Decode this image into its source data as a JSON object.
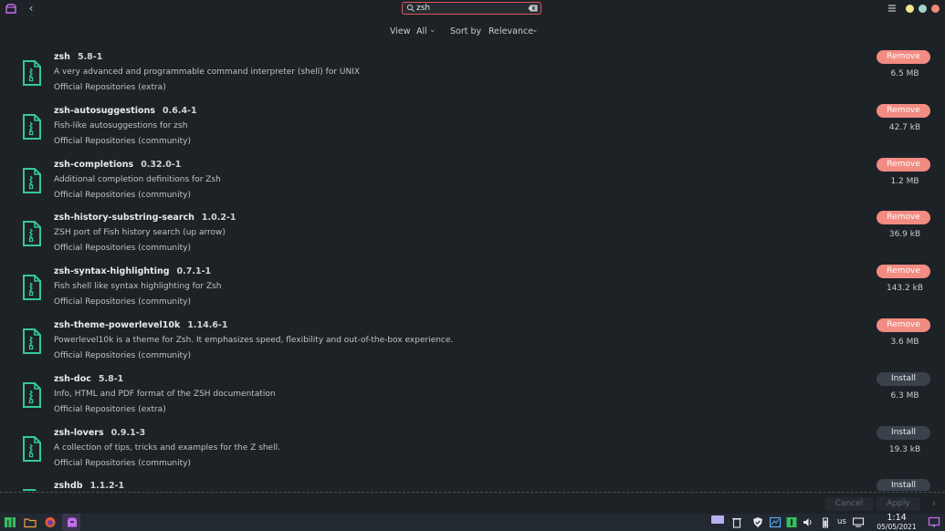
{
  "search": {
    "value": "zsh",
    "placeholder": ""
  },
  "filters": {
    "view_label": "View",
    "view_value": "All",
    "sort_label": "Sort by",
    "sort_value": "Relevance"
  },
  "packages": [
    {
      "name": "zsh",
      "version": "5.8-1",
      "description": "A very advanced and programmable command interpreter (shell) for UNIX",
      "repo": "Official Repositories (extra)",
      "action": "Remove",
      "size": "6.5 MB"
    },
    {
      "name": "zsh-autosuggestions",
      "version": "0.6.4-1",
      "description": "Fish-like autosuggestions for zsh",
      "repo": "Official Repositories (community)",
      "action": "Remove",
      "size": "42.7 kB"
    },
    {
      "name": "zsh-completions",
      "version": "0.32.0-1",
      "description": "Additional completion definitions for Zsh",
      "repo": "Official Repositories (community)",
      "action": "Remove",
      "size": "1.2 MB"
    },
    {
      "name": "zsh-history-substring-search",
      "version": "1.0.2-1",
      "description": "ZSH port of Fish history search (up arrow)",
      "repo": "Official Repositories (community)",
      "action": "Remove",
      "size": "36.9 kB"
    },
    {
      "name": "zsh-syntax-highlighting",
      "version": "0.7.1-1",
      "description": "Fish shell like syntax highlighting for Zsh",
      "repo": "Official Repositories (community)",
      "action": "Remove",
      "size": "143.2 kB"
    },
    {
      "name": "zsh-theme-powerlevel10k",
      "version": "1.14.6-1",
      "description": "Powerlevel10k is a theme for Zsh. It emphasizes speed, flexibility and out-of-the-box experience.",
      "repo": "Official Repositories (community)",
      "action": "Remove",
      "size": "3.6 MB"
    },
    {
      "name": "zsh-doc",
      "version": "5.8-1",
      "description": "Info, HTML and PDF format of the ZSH documentation",
      "repo": "Official Repositories (extra)",
      "action": "Install",
      "size": "6.3 MB"
    },
    {
      "name": "zsh-lovers",
      "version": "0.9.1-3",
      "description": "A collection of tips, tricks and examples for the Z shell.",
      "repo": "Official Repositories (community)",
      "action": "Install",
      "size": "19.3 kB"
    },
    {
      "name": "zshdb",
      "version": "1.1.2-1",
      "description": "",
      "repo": "",
      "action": "Install",
      "size": ""
    }
  ],
  "actions": {
    "cancel": "Cancel",
    "apply": "Apply"
  },
  "taskbar": {
    "lang": "us",
    "time": "1:14",
    "date": "05/05/2021"
  },
  "colors": {
    "remove": "#f28b82",
    "install": "#3a414a",
    "accent": "#e0565b",
    "icon": "#35c89a"
  }
}
